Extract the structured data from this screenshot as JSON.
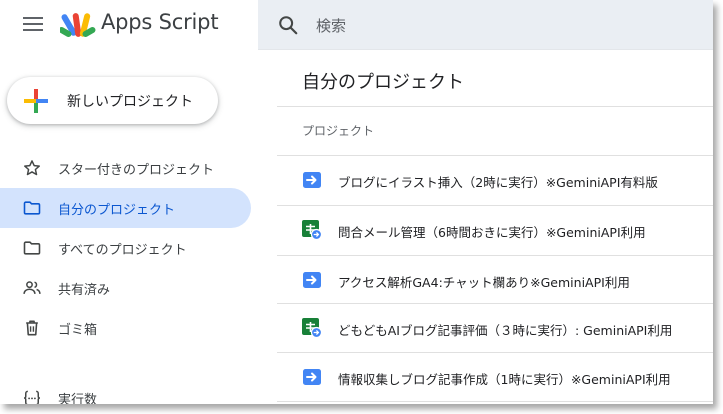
{
  "header": {
    "app_title": "Apps Script",
    "search_placeholder": "検索"
  },
  "sidebar": {
    "new_project_label": "新しいプロジェクト",
    "items": [
      {
        "label": "スター付きのプロジェクト",
        "icon": "star-icon"
      },
      {
        "label": "自分のプロジェクト",
        "icon": "folder-icon",
        "active": true
      },
      {
        "label": "すべてのプロジェクト",
        "icon": "folder-icon"
      },
      {
        "label": "共有済み",
        "icon": "people-icon"
      },
      {
        "label": "ゴミ箱",
        "icon": "trash-icon"
      },
      {
        "label": "実行数",
        "icon": "executions-icon"
      }
    ]
  },
  "main": {
    "title": "自分のプロジェクト",
    "column_header": "プロジェクト",
    "projects": [
      {
        "name": "ブログにイラスト挿入（2時に実行）※GeminiAPI有料版",
        "icon": "standalone-script-icon"
      },
      {
        "name": "問合メール管理（6時間おきに実行）※GeminiAPI利用",
        "icon": "sheets-bound-script-icon"
      },
      {
        "name": "アクセス解析GA4:チャット欄あり※GeminiAPI利用",
        "icon": "standalone-script-icon"
      },
      {
        "name": "どもどもAIブログ記事評価（３時に実行）: GeminiAPI利用",
        "icon": "sheets-bound-script-icon"
      },
      {
        "name": "情報収集しブログ記事作成（1時に実行）※GeminiAPI利用",
        "icon": "standalone-script-icon"
      }
    ]
  },
  "colors": {
    "accent": "#0b57d0",
    "active_bg": "#d3e3fd",
    "search_bg": "#eaeef3",
    "script_blue": "#4285f4",
    "sheets_green": "#188038"
  }
}
